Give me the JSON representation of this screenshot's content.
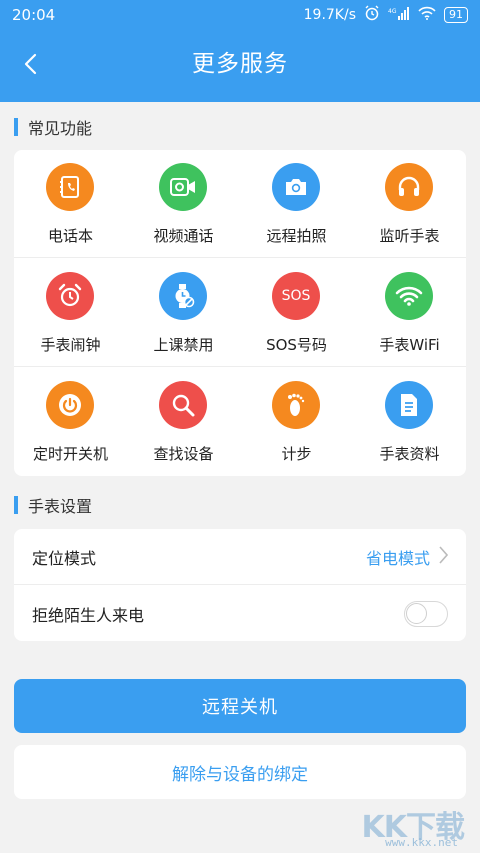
{
  "status_bar": {
    "time": "20:04",
    "speed": "19.7K/s",
    "network": "4G",
    "battery": "91"
  },
  "header": {
    "title": "更多服务",
    "back_icon": "chevron-left-icon"
  },
  "common_section": {
    "title": "常见功能"
  },
  "features": [
    {
      "label": "电话本",
      "icon": "phonebook-icon",
      "color": "#f5891f"
    },
    {
      "label": "视频通话",
      "icon": "video-call-icon",
      "color": "#3fc25e"
    },
    {
      "label": "远程拍照",
      "icon": "camera-icon",
      "color": "#3a9ef0"
    },
    {
      "label": "监听手表",
      "icon": "headphones-icon",
      "color": "#f5891f"
    },
    {
      "label": "手表闹钟",
      "icon": "alarm-clock-icon",
      "color": "#ee4f4b"
    },
    {
      "label": "上课禁用",
      "icon": "watch-disabled-icon",
      "color": "#3a9ef0"
    },
    {
      "label": "SOS号码",
      "icon": "sos-icon",
      "color": "#ee4f4b"
    },
    {
      "label": "手表WiFi",
      "icon": "wifi-icon",
      "color": "#3fc25e"
    },
    {
      "label": "定时开关机",
      "icon": "power-icon",
      "color": "#f5891f"
    },
    {
      "label": "查找设备",
      "icon": "search-icon",
      "color": "#ee4f4b"
    },
    {
      "label": "计步",
      "icon": "footprint-icon",
      "color": "#f5891f"
    },
    {
      "label": "手表资料",
      "icon": "document-icon",
      "color": "#3a9ef0"
    }
  ],
  "sos_text": "SOS",
  "settings_section": {
    "title": "手表设置"
  },
  "settings": {
    "location_label": "定位模式",
    "location_value": "省电模式",
    "reject_label": "拒绝陌生人来电",
    "reject_enabled": false
  },
  "actions": {
    "shutdown_label": "远程关机",
    "unbind_label": "解除与设备的绑定"
  },
  "watermark": {
    "logo": "KK下载",
    "url": "www.kkx.net"
  },
  "colors": {
    "accent": "#3a9ef0",
    "orange": "#f5891f",
    "green": "#3fc25e",
    "red": "#ee4f4b"
  }
}
